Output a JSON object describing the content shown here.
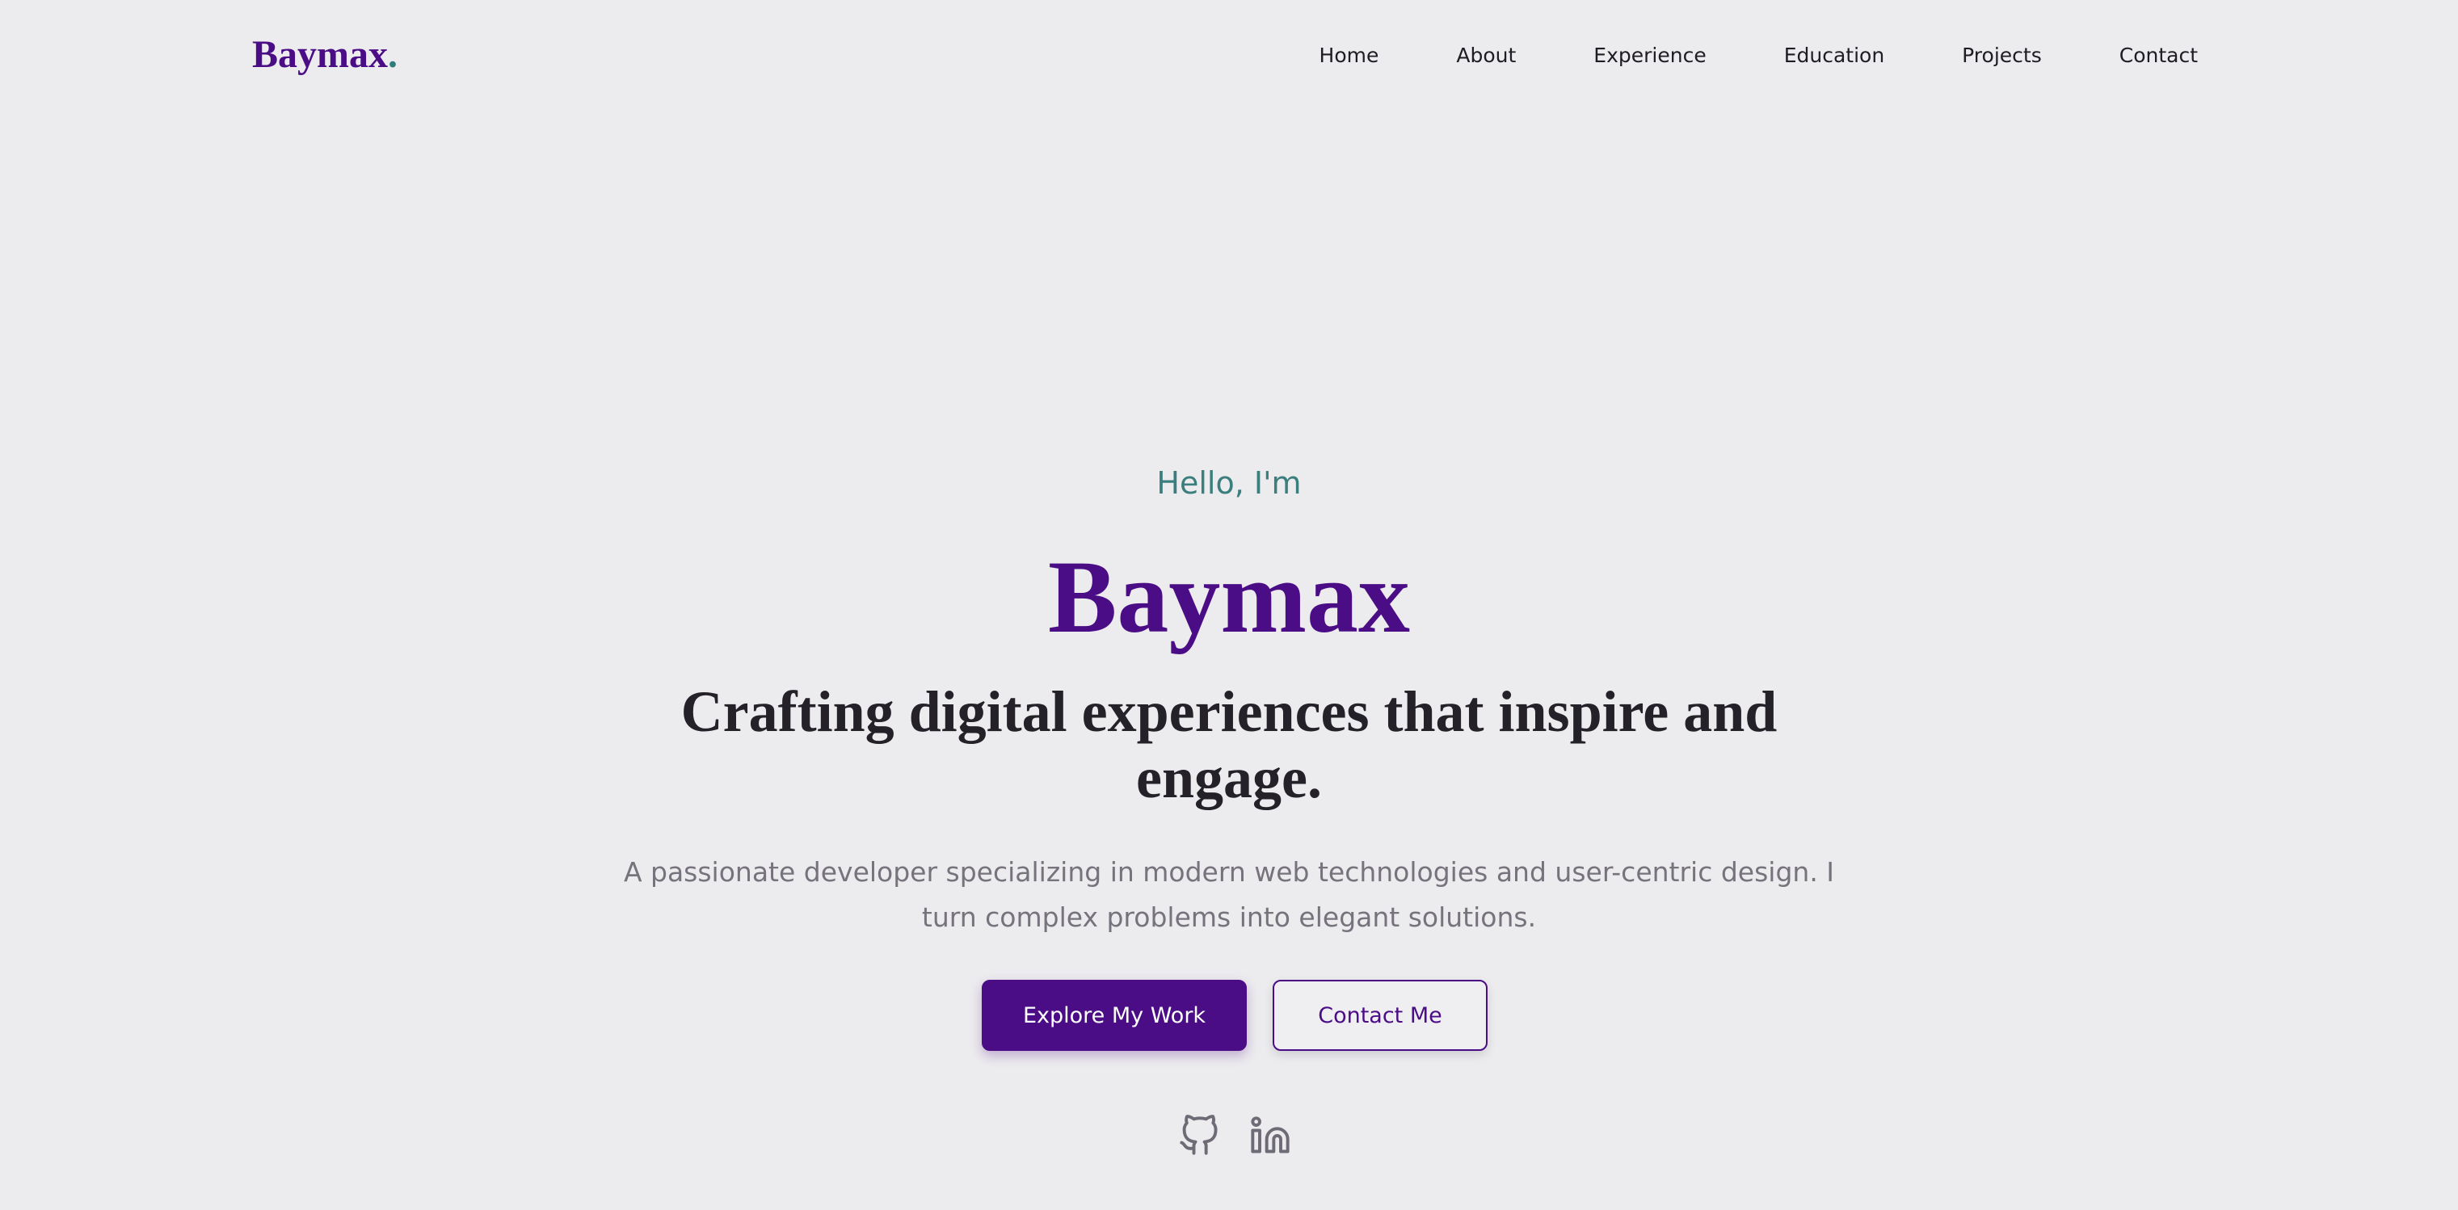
{
  "brand": {
    "name": "Baymax",
    "dot": "."
  },
  "nav": {
    "items": [
      {
        "label": "Home"
      },
      {
        "label": "About"
      },
      {
        "label": "Experience"
      },
      {
        "label": "Education"
      },
      {
        "label": "Projects"
      },
      {
        "label": "Contact"
      }
    ]
  },
  "hero": {
    "greeting": "Hello, I'm",
    "name": "Baymax",
    "tagline": "Crafting digital experiences that inspire and engage.",
    "description": "A passionate developer specializing in modern web technologies and user-centric design. I turn complex problems into elegant solutions.",
    "primary_button": "Explore My Work",
    "secondary_button": "Contact Me"
  },
  "social": {
    "icons": [
      "github-icon",
      "linkedin-icon"
    ]
  },
  "colors": {
    "accent": "#4a0d86",
    "teal": "#3b7e7e",
    "background": "#ecebee",
    "muted_text": "#77737d"
  }
}
